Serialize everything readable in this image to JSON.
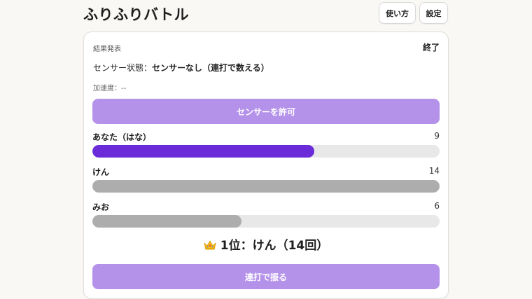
{
  "app": {
    "title": "ふりふりバトル",
    "help_label": "使い方",
    "settings_label": "設定"
  },
  "card": {
    "phase_label": "結果発表",
    "phase_status": "終了",
    "sensor_prefix": "センサー状態：",
    "sensor_value": "センサーなし（連打で数える）",
    "accel_text": "加速度：--",
    "sensor_button_label": "センサーを許可",
    "tap_button_label": "連打で振る"
  },
  "players": [
    {
      "name": "あなた（はな）",
      "count": "9",
      "progress": 0.64,
      "is_self": true
    },
    {
      "name": "けん",
      "count": "14",
      "progress": 1.0,
      "is_self": false
    },
    {
      "name": "みお",
      "count": "6",
      "progress": 0.43,
      "is_self": false
    }
  ],
  "winner": {
    "icon": "crown-icon",
    "text": "1位：けん（14回）"
  },
  "colors": {
    "accent": "#b592ea",
    "self_bar": "#6b2bd9",
    "other_bar": "#adadad",
    "track": "#e8e8e8"
  }
}
